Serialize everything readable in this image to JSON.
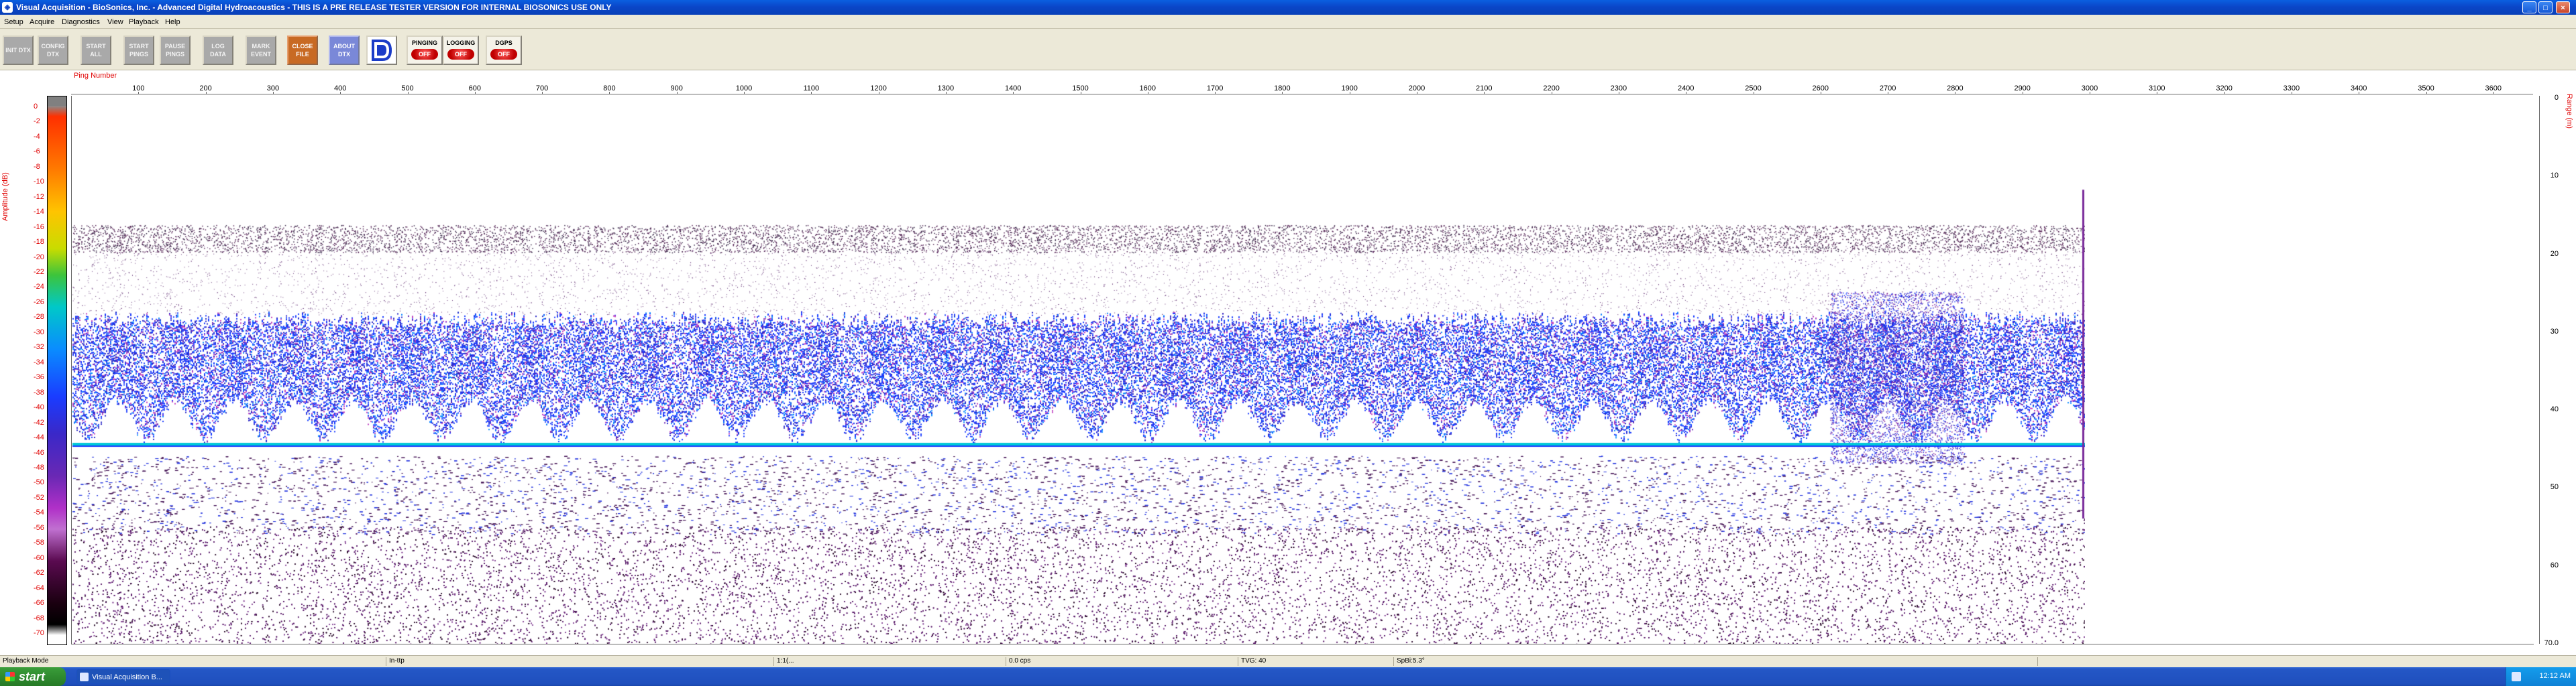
{
  "window": {
    "title": "Visual Acquisition  -  BioSonics, Inc.  -  Advanced Digital Hydroacoustics  -  THIS IS A PRE RELEASE TESTER VERSION FOR INTERNAL BIOSONICS USE ONLY",
    "controls": {
      "minimize": "_",
      "maximize": "□",
      "close": "×"
    }
  },
  "menu": [
    "Setup",
    "Acquire",
    "Diagnostics",
    "View",
    "Playback",
    "Help"
  ],
  "toolbar": {
    "buttons": [
      {
        "label": "INIT DTX",
        "style": "gray"
      },
      {
        "label": "CONFIG DTX",
        "style": "gray"
      },
      {
        "label": "START ALL",
        "style": "gray"
      },
      {
        "label": "START PINGS",
        "style": "gray"
      },
      {
        "label": "PAUSE PINGS",
        "style": "gray"
      },
      {
        "label": "LOG DATA",
        "style": "gray"
      },
      {
        "label": "MARK EVENT",
        "style": "gray"
      },
      {
        "label": "CLOSE FILE",
        "style": "orange"
      },
      {
        "label": "ABOUT DTX",
        "style": "blue"
      }
    ],
    "logo_icon": "biosonics-logo-icon",
    "indicators": [
      {
        "label": "PINGING",
        "state": "OFF"
      },
      {
        "label": "LOGGING",
        "state": "OFF"
      },
      {
        "label": "DGPS",
        "state": "OFF"
      }
    ]
  },
  "echogram": {
    "x_axis_title": "Ping Number",
    "x_ticks": [
      "100",
      "200",
      "300",
      "400",
      "500",
      "600",
      "700",
      "800",
      "900",
      "1000",
      "1100",
      "1200",
      "1300",
      "1400",
      "1500",
      "1600",
      "1700",
      "1800",
      "1900",
      "2000",
      "2100",
      "2200",
      "2300",
      "2400",
      "2500",
      "2600",
      "2700",
      "2800",
      "2900",
      "3000",
      "3100",
      "3200",
      "3300",
      "3400",
      "3500",
      "3600"
    ],
    "amplitude_axis_title": "Amplitude (dB)",
    "amplitude_ticks": [
      "0",
      "-2",
      "-4",
      "-6",
      "-8",
      "-10",
      "-12",
      "-14",
      "-16",
      "-18",
      "-20",
      "-22",
      "-24",
      "-26",
      "-28",
      "-30",
      "-32",
      "-34",
      "-36",
      "-38",
      "-40",
      "-42",
      "-44",
      "-46",
      "-48",
      "-50",
      "-52",
      "-54",
      "-56",
      "-58",
      "-60",
      "-62",
      "-64",
      "-66",
      "-68",
      "-70"
    ],
    "range_axis_title": "Range (m)",
    "range_ticks": [
      "0",
      "10",
      "20",
      "30",
      "40",
      "50",
      "60",
      "70.0"
    ],
    "data_extent_pings": 3000,
    "bottom_line_range_m": 44.5,
    "colors": {
      "fish_band": "#1a3cff",
      "bottom_line": "#00c8d8",
      "noise": "#5a1a6a"
    }
  },
  "statusbar": {
    "fields": [
      "Playback Mode",
      "In-ttp",
      "1:1(...",
      "0.0 cps",
      "TVG: 40",
      "SpBi:5.3°"
    ]
  },
  "taskbar": {
    "start_label": "start",
    "tasks": [
      "Visual Acquisition",
      "B..."
    ],
    "clock": "12:12 AM"
  }
}
